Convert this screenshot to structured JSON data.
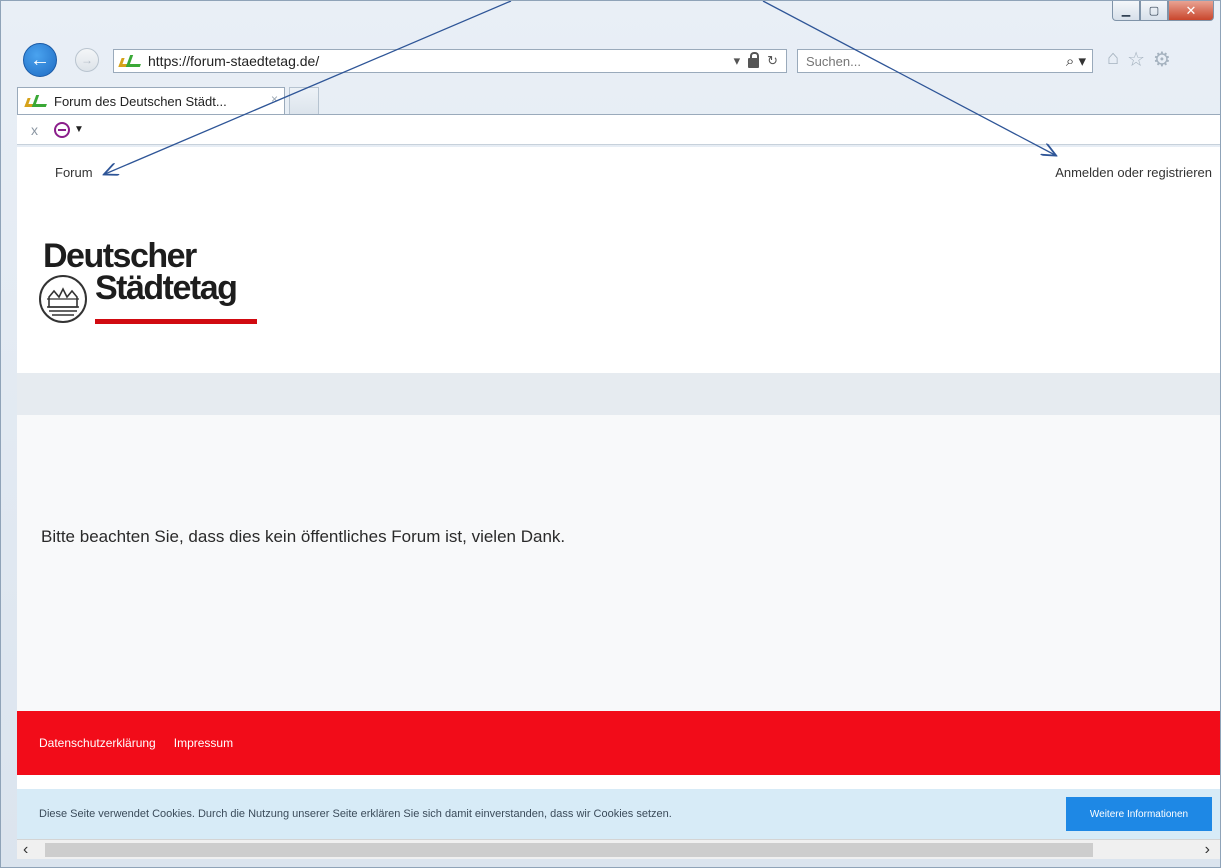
{
  "browser": {
    "address_url": "https://forum-staedtetag.de/",
    "search_placeholder": "Suchen...",
    "tab_title": "Forum des Deutschen Städt...",
    "tab_close": "×",
    "cmd_close": "x"
  },
  "page": {
    "nav_forum": "Forum",
    "nav_login": "Anmelden oder registrieren",
    "logo_line1": "Deutscher",
    "logo_line2": "Städtetag",
    "notice": "Bitte beachten Sie, dass dies kein öffentliches Forum ist, vielen Dank.",
    "footer_links": [
      "Datenschutzerklärung",
      "Impressum"
    ],
    "cookie_text": "Diese Seite verwendet Cookies. Durch die Nutzung unserer Seite erklären Sie sich damit einverstanden, dass wir Cookies setzen.",
    "cookie_button": "Weitere Informationen"
  },
  "colors": {
    "footer_red": "#f20c19",
    "logo_red": "#d10a11",
    "cookie_bg": "#d7ebf7",
    "cookie_button": "#1e88e5",
    "annotation_arrow": "#2e5597"
  }
}
